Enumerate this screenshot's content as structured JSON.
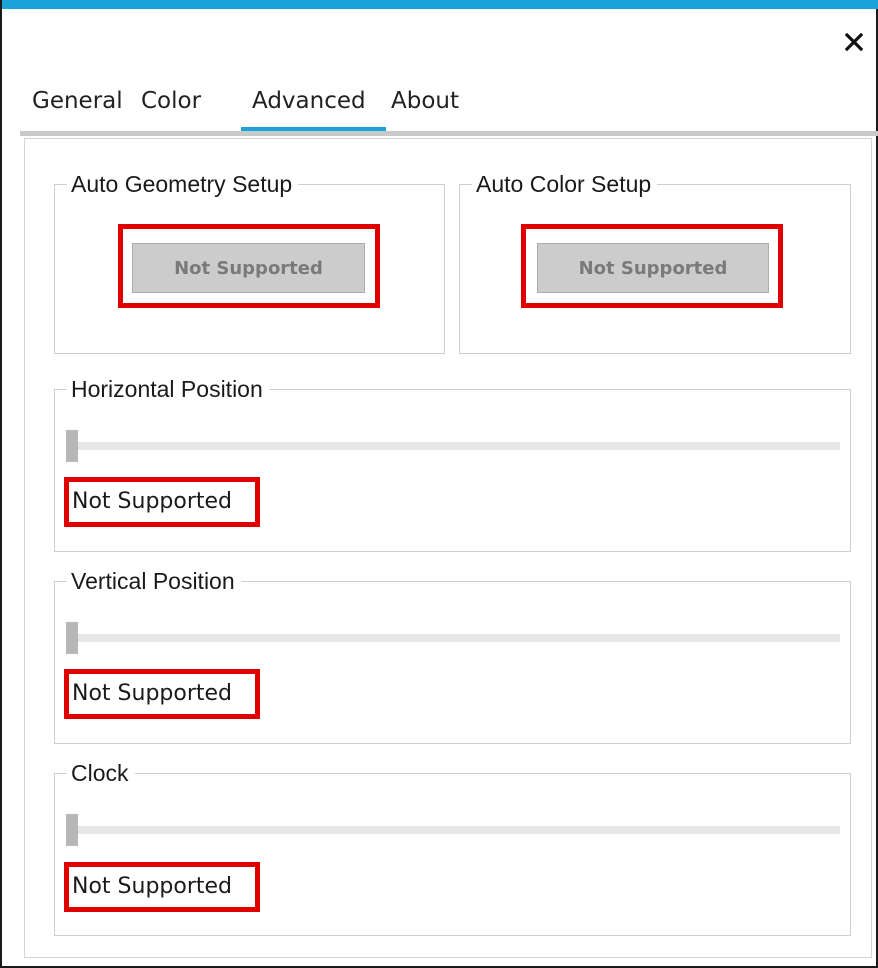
{
  "window": {
    "accent_color": "#1aa3d8",
    "close_icon": "close-icon"
  },
  "tabs": [
    {
      "label": "General",
      "selected": false
    },
    {
      "label": "Color",
      "selected": false
    },
    {
      "label": "Advanced",
      "selected": true
    },
    {
      "label": "About",
      "selected": false
    }
  ],
  "advanced": {
    "auto_geometry": {
      "title": "Auto Geometry Setup",
      "button_label": "Not Supported",
      "enabled": false
    },
    "auto_color": {
      "title": "Auto Color Setup",
      "button_label": "Not Supported",
      "enabled": false
    },
    "horizontal_position": {
      "title": "Horizontal Position",
      "value_text": "Not Supported",
      "slider_level": 0
    },
    "vertical_position": {
      "title": "Vertical Position",
      "value_text": "Not Supported",
      "slider_level": 0
    },
    "clock": {
      "title": "Clock",
      "value_text": "Not Supported",
      "slider_level": 0
    }
  },
  "highlight_color": "#e00000"
}
